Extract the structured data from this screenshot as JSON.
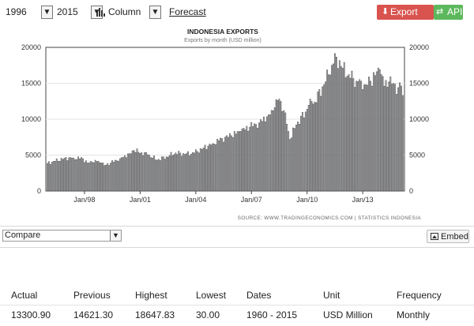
{
  "toolbar": {
    "start_year": "1996",
    "end_year": "2015",
    "chart_type": "Column",
    "forecast_label": "Forecast",
    "export_label": "Export Data",
    "api_label": "API",
    "select_arrow": "▼",
    "download_icon": "⬇",
    "api_icon": "⇄"
  },
  "colors": {
    "export_button": "#d9534f",
    "api_button": "#5cb85c",
    "bar_fill": "#d2d4da",
    "bar_stroke": "#4a4a4a"
  },
  "chart_data": {
    "type": "bar",
    "title": "INDONESIA EXPORTS",
    "subtitle": "Exports by month (USD million)",
    "source": "SOURCE: WWW.TRADINGECONOMICS.COM | STATISTICS INDONESIA",
    "x_tick_labels": [
      "Jan/98",
      "Jan/01",
      "Jan/04",
      "Jan/07",
      "Jan/10",
      "Jan/13"
    ],
    "y_ticks": [
      0,
      5000,
      10000,
      15000,
      20000
    ],
    "ylim": [
      0,
      20000
    ],
    "left_axis_labels": [
      "0",
      "5000",
      "10000",
      "15000",
      "20000"
    ],
    "right_axis_labels": [
      "0",
      "5000",
      "10000",
      "15000",
      "20000"
    ],
    "anchors": [
      [
        "1996-01",
        3850
      ],
      [
        "1996-06",
        4150
      ],
      [
        "1996-12",
        4550
      ],
      [
        "1997-06",
        4600
      ],
      [
        "1997-12",
        4500
      ],
      [
        "1998-03",
        3900
      ],
      [
        "1998-06",
        4000
      ],
      [
        "1998-09",
        4100
      ],
      [
        "1998-12",
        3900
      ],
      [
        "1999-02",
        3550
      ],
      [
        "1999-06",
        3900
      ],
      [
        "1999-12",
        4500
      ],
      [
        "2000-06",
        5200
      ],
      [
        "2000-09",
        5650
      ],
      [
        "2000-12",
        5400
      ],
      [
        "2001-06",
        5050
      ],
      [
        "2001-12",
        4300
      ],
      [
        "2002-06",
        4750
      ],
      [
        "2002-12",
        5300
      ],
      [
        "2003-06",
        5100
      ],
      [
        "2003-12",
        5300
      ],
      [
        "2004-06",
        6000
      ],
      [
        "2004-12",
        6600
      ],
      [
        "2005-06",
        7300
      ],
      [
        "2005-12",
        7700
      ],
      [
        "2006-06",
        8300
      ],
      [
        "2006-12",
        8900
      ],
      [
        "2007-06",
        9500
      ],
      [
        "2007-12",
        10600
      ],
      [
        "2008-04",
        11600
      ],
      [
        "2008-07",
        12800
      ],
      [
        "2008-10",
        11200
      ],
      [
        "2008-12",
        9300
      ],
      [
        "2009-02",
        7200
      ],
      [
        "2009-06",
        9200
      ],
      [
        "2009-12",
        11000
      ],
      [
        "2010-03",
        12800
      ],
      [
        "2010-06",
        12400
      ],
      [
        "2010-12",
        14800
      ],
      [
        "2011-03",
        16200
      ],
      [
        "2011-06",
        17700
      ],
      [
        "2011-08",
        18648
      ],
      [
        "2011-12",
        17100
      ],
      [
        "2012-04",
        16200
      ],
      [
        "2012-09",
        15300
      ],
      [
        "2012-12",
        15300
      ],
      [
        "2013-03",
        14800
      ],
      [
        "2013-06",
        15300
      ],
      [
        "2013-12",
        16900
      ],
      [
        "2014-03",
        14600
      ],
      [
        "2014-06",
        15200
      ],
      [
        "2014-12",
        14400
      ],
      [
        "2015-02",
        14621.3
      ],
      [
        "2015-03",
        13300.9
      ]
    ]
  },
  "compare": {
    "label": "Compare",
    "embed_label": "Embed",
    "embed_icon": "image-icon"
  },
  "stats": {
    "headers": [
      "Actual",
      "Previous",
      "Highest",
      "Lowest",
      "Dates",
      "Unit",
      "Frequency"
    ],
    "values": [
      "13300.90",
      "14621.30",
      "18647.83",
      "30.00",
      "1960 - 2015",
      "USD Million",
      "Monthly"
    ]
  }
}
